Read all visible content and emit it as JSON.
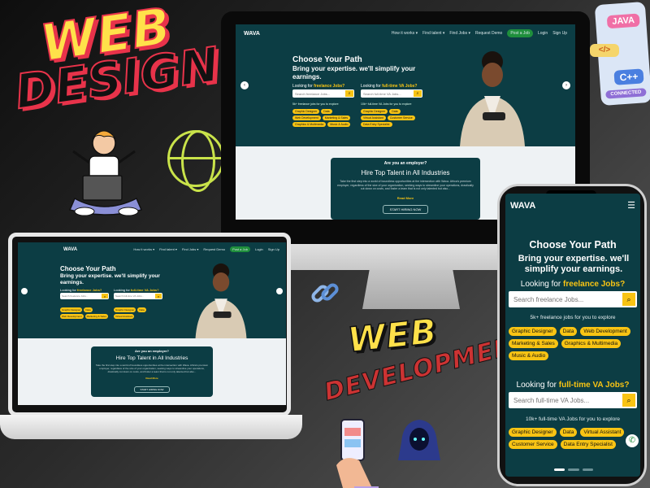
{
  "titles": {
    "web": "WEB",
    "design": "DESIGN",
    "web2": "WEB",
    "development": "DEVELOPMENT"
  },
  "badges": {
    "java": "JAVA",
    "html": "</>",
    "cpp": "C++",
    "connected": "CONNECTED"
  },
  "site": {
    "logo": "WAVA",
    "nav": [
      "How it works ▾",
      "Find talent ▾",
      "Find Jobs ▾",
      "Request Demo"
    ],
    "post_job": "Post a Job",
    "login": "Login",
    "signup": "Sign Up",
    "hero_title": "Choose Your Path",
    "hero_sub": "Bring your expertise. we'll simplify your earnings.",
    "looking_prefix": "Looking for",
    "freelance_kw": "freelance Jobs?",
    "fulltime_kw": "full-time VA Jobs?",
    "freelance_placeholder": "Search freelance Jobs...",
    "fulltime_placeholder": "Search full-time VA Jobs...",
    "freelance_count": "5k+ freelance jobs for you to explore",
    "fulltime_count": "10k+ full-time VA Jobs for you to explore",
    "freelance_chips": [
      "Graphic Designer",
      "Data",
      "Web Development",
      "Marketing & Sales",
      "Graphics & Multimedia",
      "Music & Audio"
    ],
    "fulltime_chips": [
      "Graphic Designer",
      "Data",
      "Virtual Assistant",
      "Customer Service",
      "Data Entry Specialist"
    ],
    "employer_q": "Are you an employer?",
    "employer_h": "Hire Top Talent in All Industries",
    "employer_p": "Take the first step into a world of boundless opportunities at the intersection with Wava. Africa's premium employer, regardless of the size of your organization, seeking ways to streamline your operations, drastically cut down on costs, and foster a team that is not only talented but also...",
    "read_more": "Read More",
    "cta": "START HIRING NOW"
  },
  "colors": {
    "site_bg": "#0c3d44",
    "accent": "#f8c414",
    "green": "#1f8f3c",
    "title_yellow": "#ffe14a",
    "title_red": "#e8334a"
  },
  "icons": [
    "search-icon",
    "chevron-left-icon",
    "chevron-right-icon",
    "menu-icon",
    "globe-icon",
    "link-icon",
    "hacker-icon",
    "person-with-laptop",
    "hand-with-phone",
    "whatsapp-icon"
  ]
}
